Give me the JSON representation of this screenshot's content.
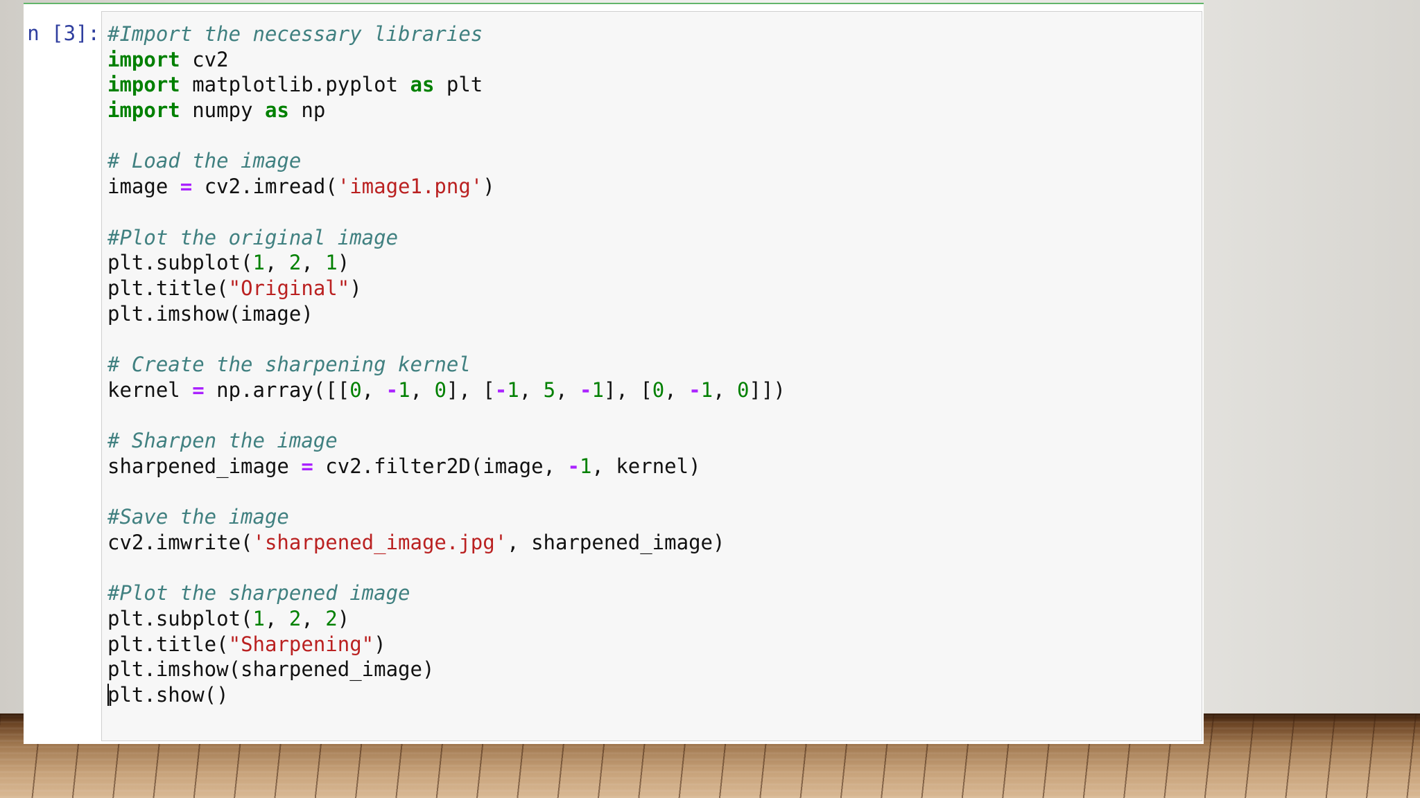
{
  "cell": {
    "prompt": "n [3]:",
    "lines": [
      [
        {
          "t": "cm",
          "v": "#Import the necessary libraries"
        }
      ],
      [
        {
          "t": "kw",
          "v": "import"
        },
        {
          "t": "",
          "v": " cv2"
        }
      ],
      [
        {
          "t": "kw",
          "v": "import"
        },
        {
          "t": "",
          "v": " matplotlib.pyplot "
        },
        {
          "t": "kw",
          "v": "as"
        },
        {
          "t": "",
          "v": " plt"
        }
      ],
      [
        {
          "t": "kw",
          "v": "import"
        },
        {
          "t": "",
          "v": " numpy "
        },
        {
          "t": "kw",
          "v": "as"
        },
        {
          "t": "",
          "v": " np"
        }
      ],
      [],
      [
        {
          "t": "cm",
          "v": "# Load the image"
        }
      ],
      [
        {
          "t": "",
          "v": "image "
        },
        {
          "t": "op",
          "v": "="
        },
        {
          "t": "",
          "v": " cv2.imread("
        },
        {
          "t": "st",
          "v": "'image1.png'"
        },
        {
          "t": "",
          "v": ")"
        }
      ],
      [],
      [
        {
          "t": "cm",
          "v": "#Plot the original image"
        }
      ],
      [
        {
          "t": "",
          "v": "plt.subplot("
        },
        {
          "t": "nm",
          "v": "1"
        },
        {
          "t": "",
          "v": ", "
        },
        {
          "t": "nm",
          "v": "2"
        },
        {
          "t": "",
          "v": ", "
        },
        {
          "t": "nm",
          "v": "1"
        },
        {
          "t": "",
          "v": ")"
        }
      ],
      [
        {
          "t": "",
          "v": "plt.title("
        },
        {
          "t": "st",
          "v": "\"Original\""
        },
        {
          "t": "",
          "v": ")"
        }
      ],
      [
        {
          "t": "",
          "v": "plt.imshow(image)"
        }
      ],
      [],
      [
        {
          "t": "cm",
          "v": "# Create the sharpening kernel"
        }
      ],
      [
        {
          "t": "",
          "v": "kernel "
        },
        {
          "t": "op",
          "v": "="
        },
        {
          "t": "",
          "v": " np.array([["
        },
        {
          "t": "nm",
          "v": "0"
        },
        {
          "t": "",
          "v": ", "
        },
        {
          "t": "op",
          "v": "-"
        },
        {
          "t": "nm",
          "v": "1"
        },
        {
          "t": "",
          "v": ", "
        },
        {
          "t": "nm",
          "v": "0"
        },
        {
          "t": "",
          "v": "], ["
        },
        {
          "t": "op",
          "v": "-"
        },
        {
          "t": "nm",
          "v": "1"
        },
        {
          "t": "",
          "v": ", "
        },
        {
          "t": "nm",
          "v": "5"
        },
        {
          "t": "",
          "v": ", "
        },
        {
          "t": "op",
          "v": "-"
        },
        {
          "t": "nm",
          "v": "1"
        },
        {
          "t": "",
          "v": "], ["
        },
        {
          "t": "nm",
          "v": "0"
        },
        {
          "t": "",
          "v": ", "
        },
        {
          "t": "op",
          "v": "-"
        },
        {
          "t": "nm",
          "v": "1"
        },
        {
          "t": "",
          "v": ", "
        },
        {
          "t": "nm",
          "v": "0"
        },
        {
          "t": "",
          "v": "]])"
        }
      ],
      [],
      [
        {
          "t": "cm",
          "v": "# Sharpen the image"
        }
      ],
      [
        {
          "t": "",
          "v": "sharpened_image "
        },
        {
          "t": "op",
          "v": "="
        },
        {
          "t": "",
          "v": " cv2.filter2D(image, "
        },
        {
          "t": "op",
          "v": "-"
        },
        {
          "t": "nm",
          "v": "1"
        },
        {
          "t": "",
          "v": ", kernel)"
        }
      ],
      [],
      [
        {
          "t": "cm",
          "v": "#Save the image"
        }
      ],
      [
        {
          "t": "",
          "v": "cv2.imwrite("
        },
        {
          "t": "st",
          "v": "'sharpened_image.jpg'"
        },
        {
          "t": "",
          "v": ", sharpened_image)"
        }
      ],
      [],
      [
        {
          "t": "cm",
          "v": "#Plot the sharpened image"
        }
      ],
      [
        {
          "t": "",
          "v": "plt.subplot("
        },
        {
          "t": "nm",
          "v": "1"
        },
        {
          "t": "",
          "v": ", "
        },
        {
          "t": "nm",
          "v": "2"
        },
        {
          "t": "",
          "v": ", "
        },
        {
          "t": "nm",
          "v": "2"
        },
        {
          "t": "",
          "v": ")"
        }
      ],
      [
        {
          "t": "",
          "v": "plt.title("
        },
        {
          "t": "st",
          "v": "\"Sharpening\""
        },
        {
          "t": "",
          "v": ")"
        }
      ],
      [
        {
          "t": "",
          "v": "plt.imshow(sharpened_image)"
        }
      ],
      [
        {
          "t": "cursor",
          "v": ""
        },
        {
          "t": "",
          "v": "plt.show()"
        }
      ]
    ]
  },
  "colors": {
    "keyword": "#008000",
    "comment": "#408080",
    "string": "#ba2121",
    "number": "#008000",
    "operator": "#aa22ff",
    "prompt": "#303f9f",
    "cell_border_active": "#62b56a"
  }
}
